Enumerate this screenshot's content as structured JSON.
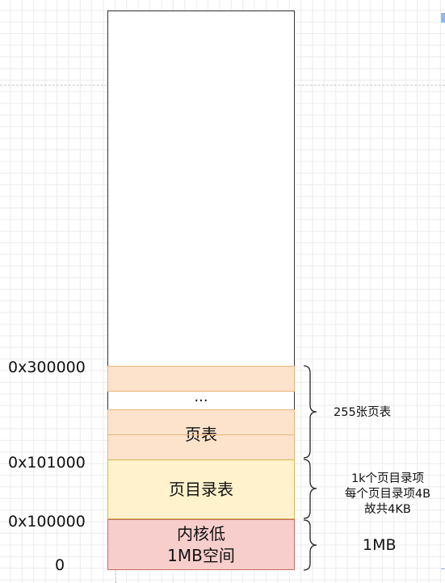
{
  "memory_layout": {
    "blocks": {
      "page_table_1": "",
      "ellipsis": "...",
      "page_table_2": "页表",
      "page_table_3": "",
      "page_directory": "页目录表",
      "kernel_line1": "内核低",
      "kernel_line2": "1MB空间"
    },
    "addresses": {
      "a300000": "0x300000",
      "a101000": "0x101000",
      "a100000": "0x100000",
      "a0": "0"
    },
    "annotations": {
      "page_tables": "255张页表",
      "page_directory_line1": "1k个页目录项",
      "page_directory_line2": "每个页目录项4B",
      "page_directory_line3": "故共4KB",
      "kernel": "1MB"
    }
  },
  "colors": {
    "page_table_fill": "#fde3cc",
    "page_directory_fill": "#fff2cc",
    "kernel_fill": "#f8cecc"
  }
}
